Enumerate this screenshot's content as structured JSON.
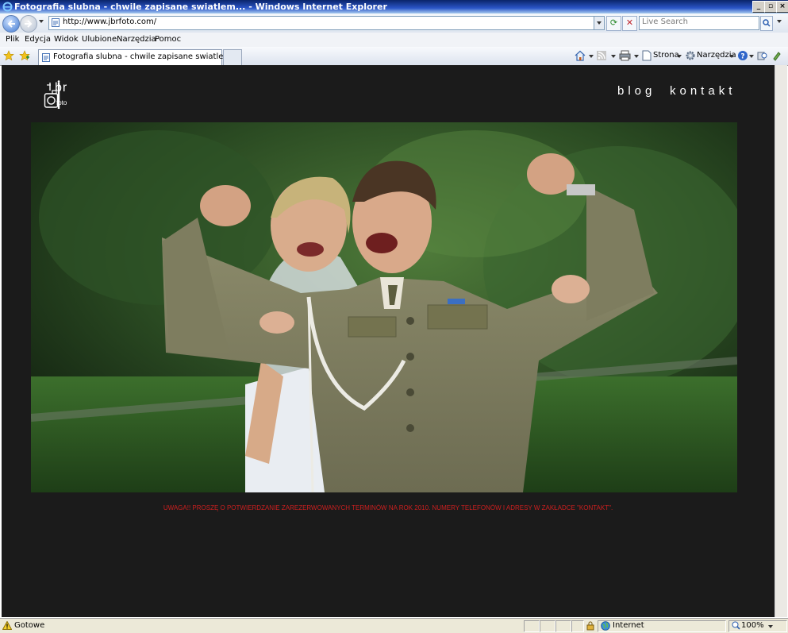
{
  "window": {
    "title": "Fotografia slubna - chwile zapisane swiatlem... - Windows Internet Explorer",
    "controls": [
      "_",
      "▫",
      "×"
    ]
  },
  "address_bar": {
    "url": "http://www.jbrfoto.com/"
  },
  "search": {
    "placeholder": "Live Search"
  },
  "menu": {
    "items": [
      "Plik",
      "Edycja",
      "Widok",
      "Ulubione",
      "Narzędzia",
      "Pomoc"
    ]
  },
  "tab": {
    "label": "Fotografia slubna - chwile zapisane swiatlem..."
  },
  "command_bar": {
    "page_label": "Strona",
    "tools_label": "Narzędzia"
  },
  "page": {
    "logo": {
      "letters": "br",
      "subtitle": "foto"
    },
    "nav": [
      "blog",
      "kontakt"
    ],
    "notice": "UWAGA!! PROSZĘ O POTWIERDZANIE ZAREZERWOWANYCH TERMINÓW NA ROK 2010. NUMERY TELEFONÓW I ADRESY W ZAKŁADCE \"KONTAKT\".",
    "colors": {
      "background": "#1b1b1b",
      "notice": "#cc1f1f",
      "nav_text": "#ffffff"
    }
  },
  "status_bar": {
    "status": "Gotowe",
    "zone": "Internet",
    "zoom": "100%"
  }
}
